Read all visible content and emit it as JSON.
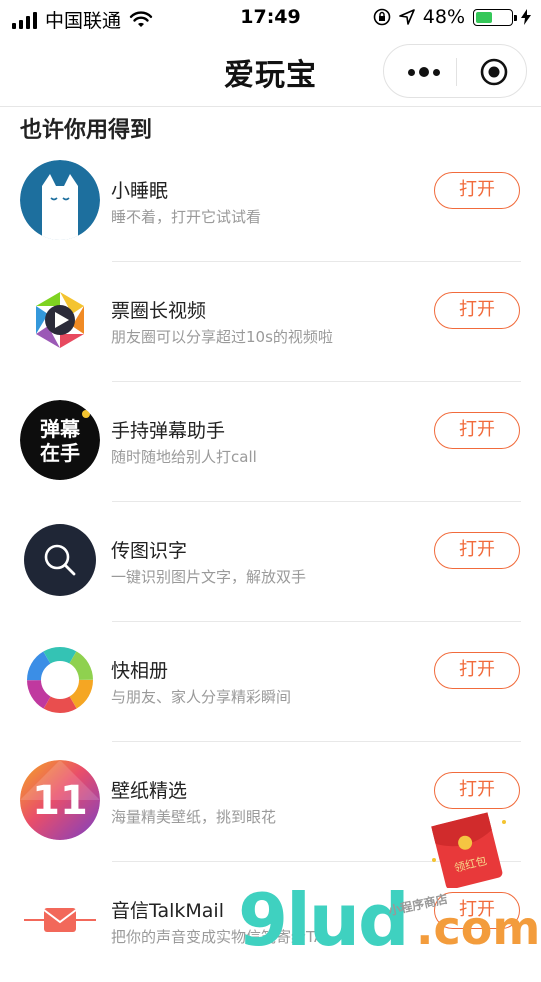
{
  "status_bar": {
    "carrier": "中国联通",
    "time": "17:49",
    "battery_percent": "48%",
    "battery_level": 0.48,
    "battery_color": "#35c759",
    "icons": [
      "signal-icon",
      "wifi-icon",
      "lock-rotation-icon",
      "location-arrow-icon",
      "battery-icon",
      "charging-bolt-icon"
    ]
  },
  "nav": {
    "title": "爱玩宝",
    "capsule_icons": [
      "more-dots-icon",
      "close-target-icon"
    ]
  },
  "section_title": "也许你用得到",
  "accent_color": "#f16b3c",
  "apps": [
    {
      "name": "小睡眠",
      "desc": "睡不着，打开它试试看",
      "button": "打开",
      "icon": "sleep-cat-icon"
    },
    {
      "name": "票圈长视频",
      "desc": "朋友圈可以分享超过10s的视频啦",
      "button": "打开",
      "icon": "aperture-play-icon"
    },
    {
      "name": "手持弹幕助手",
      "desc": "随时随地给别人打call",
      "button": "打开",
      "icon": "danmaku-icon",
      "icon_text_1": "弹幕",
      "icon_text_2": "在手"
    },
    {
      "name": "传图识字",
      "desc": "一键识别图片文字，解放双手",
      "button": "打开",
      "icon": "magnifier-icon"
    },
    {
      "name": "快相册",
      "desc": "与朋友、家人分享精彩瞬间",
      "button": "打开",
      "icon": "rainbow-ring-icon"
    },
    {
      "name": "壁纸精选",
      "desc": "海量精美壁纸，挑到眼花",
      "button": "打开",
      "icon": "wallpaper-11-icon",
      "icon_text": "11"
    },
    {
      "name": "音信TalkMail",
      "desc": "把你的声音变成实物信笺寄给TA",
      "button": "打开",
      "icon": "envelope-icon"
    }
  ],
  "overlay": {
    "red_packet_label": "领红包",
    "watermark_main": "9lud",
    "watermark_com": ".com",
    "watermark_small": "小程序商店"
  }
}
